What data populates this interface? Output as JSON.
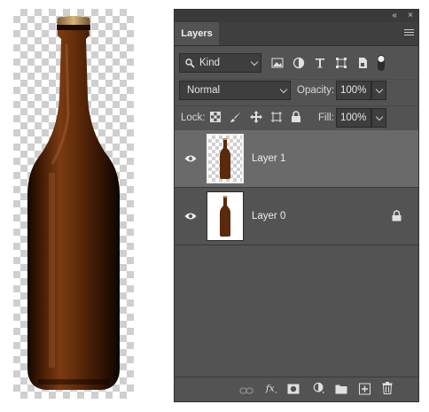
{
  "panel": {
    "tab_label": "Layers",
    "collapse_glyph": "«",
    "close_glyph": "×",
    "menu_icon": "panel-menu-icon"
  },
  "filter": {
    "kind_label": "Kind",
    "icons": [
      "pixel-filter-icon",
      "adjustment-filter-icon",
      "type-filter-icon",
      "shape-filter-icon",
      "smart-object-filter-icon",
      "filter-toggle-icon"
    ]
  },
  "blend": {
    "mode": "Normal",
    "opacity_label": "Opacity:",
    "opacity_value": "100%"
  },
  "lock": {
    "label": "Lock:",
    "icons": [
      "lock-transparent-icon",
      "lock-image-icon",
      "lock-position-icon",
      "lock-artboard-icon",
      "lock-all-icon"
    ],
    "fill_label": "Fill:",
    "fill_value": "100%"
  },
  "layers": [
    {
      "name": "Layer 1",
      "selected": true,
      "transparent_bg": true,
      "locked": false
    },
    {
      "name": "Layer 0",
      "selected": false,
      "transparent_bg": false,
      "locked": true
    }
  ],
  "footer_icons": [
    "link-layers-icon",
    "fx-icon",
    "add-mask-icon",
    "adjustment-layer-icon",
    "new-group-icon",
    "new-layer-icon",
    "trash-icon"
  ],
  "colors": {
    "panel_bg": "#535353",
    "selected_row": "#6a6a6a",
    "bottle_brown": "#5a2a0c",
    "cap_gold": "#b8935a"
  }
}
